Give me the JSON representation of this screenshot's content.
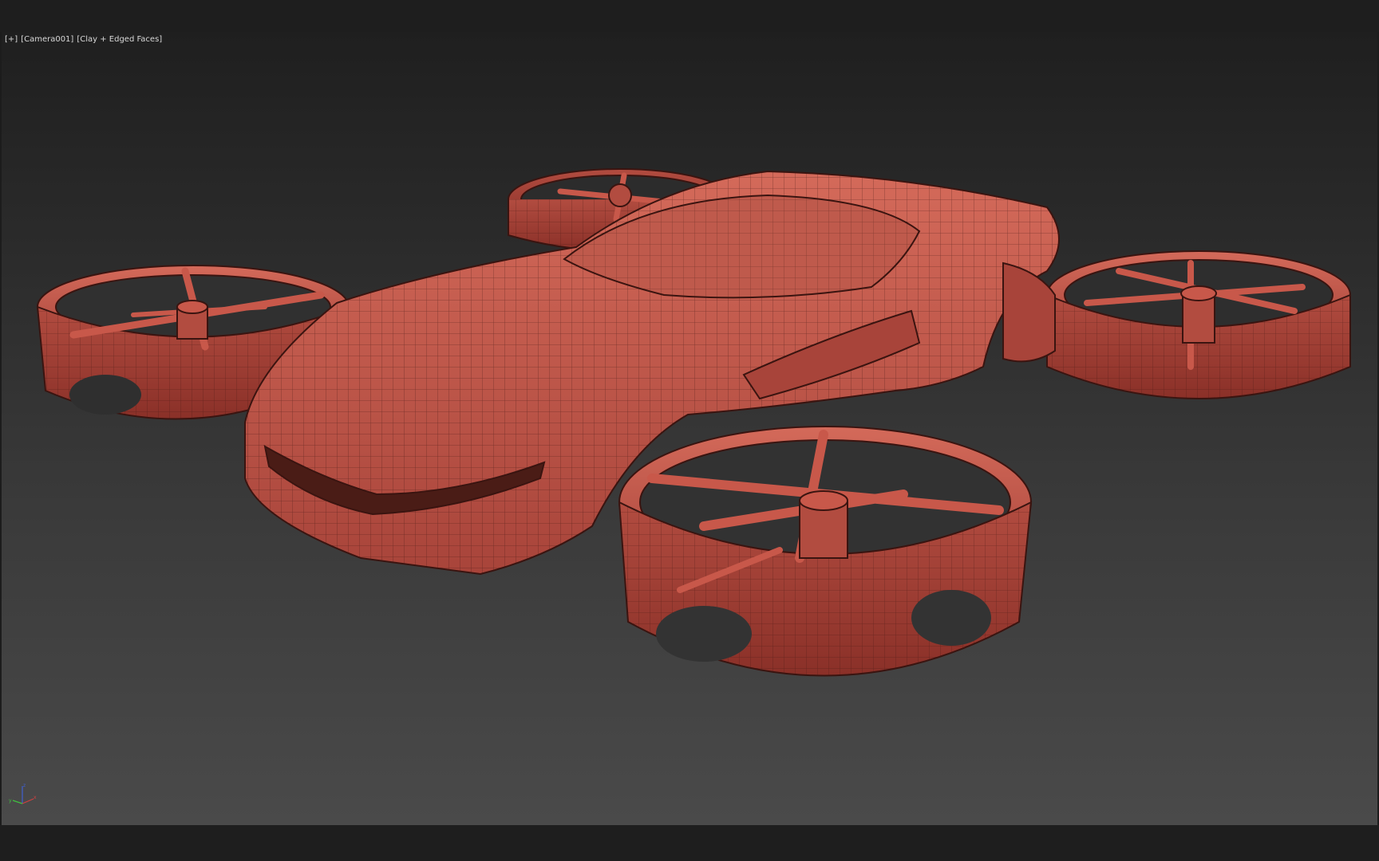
{
  "viewport": {
    "menu_label": "[+]",
    "camera_label": "[Camera001]",
    "shading_label": "[Clay + Edged Faces]"
  },
  "axis": {
    "x_label": "x",
    "y_label": "y",
    "z_label": "z",
    "x_color": "#d04040",
    "y_color": "#40c040",
    "z_color": "#4060d0"
  },
  "model": {
    "type": "flying-car-drone",
    "clay_color": "#c8584a",
    "wire_color": "#3a1410"
  }
}
